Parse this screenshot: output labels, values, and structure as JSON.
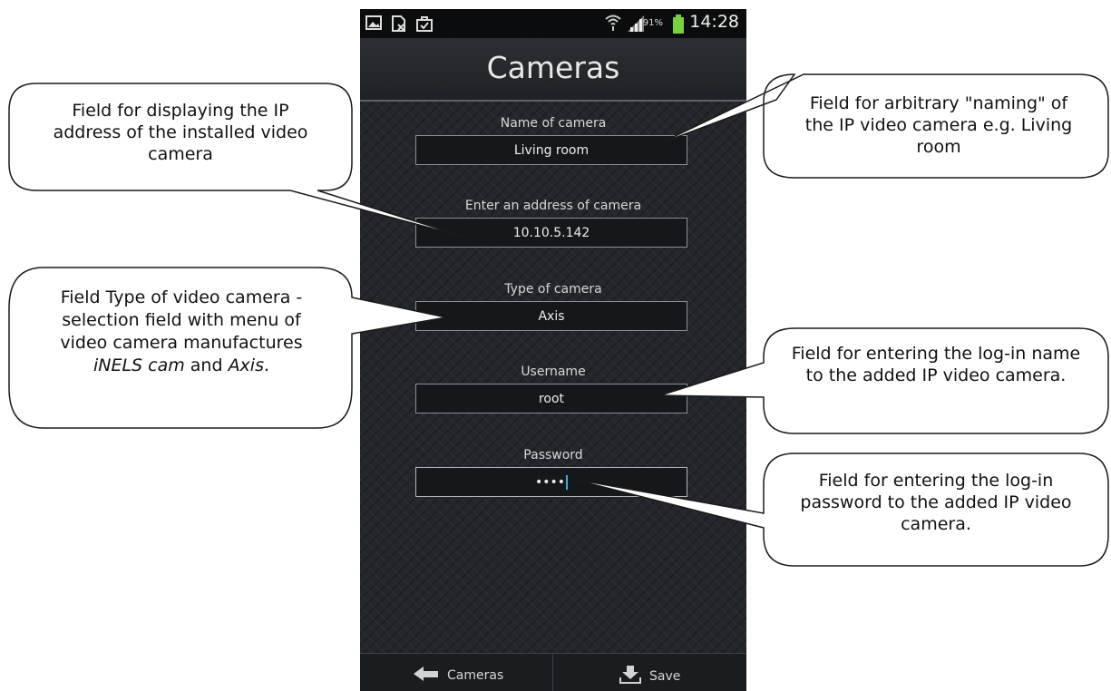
{
  "status_bar": {
    "battery_percent": "91%",
    "time": "14:28"
  },
  "app": {
    "title": "Cameras"
  },
  "form": {
    "name_label": "Name of camera",
    "name_value": "Living room",
    "address_label": "Enter an address of camera",
    "address_value": "10.10.5.142",
    "type_label": "Type of camera",
    "type_value": "Axis",
    "username_label": "Username",
    "username_value": "root",
    "password_label": "Password",
    "password_value": "••••"
  },
  "bottom_bar": {
    "back_label": "Cameras",
    "save_label": "Save"
  },
  "callouts": {
    "ip_address": "Field for displaying the IP address of the installed video camera",
    "naming": "Field for arbitrary \"naming\" of the IP video camera e.g. Living room",
    "type_line1": "Field Type of video camera -",
    "type_line2": "selection field with menu of",
    "type_line3": "video camera manufactures",
    "type_line4_a": "iNELS cam",
    "type_line4_b": " and ",
    "type_line4_c": "Axis",
    "type_line4_d": ".",
    "username": "Field for entering the log-in name to the added IP video camera.",
    "password": "Field for entering the log-in password to the added IP video camera."
  },
  "colors": {
    "accent_caret": "#33b5e5",
    "battery_green": "#7ad13b"
  }
}
